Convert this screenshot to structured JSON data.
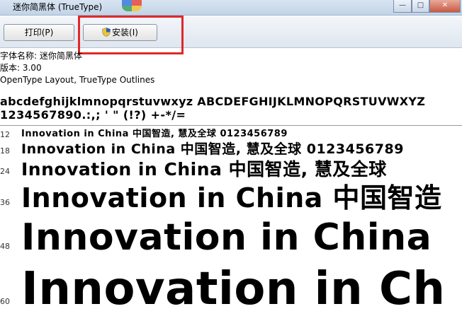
{
  "window": {
    "title": "迷你简黑体 (TrueType)",
    "controls": {
      "minimize": "—",
      "maximize": "□",
      "close": "✕"
    }
  },
  "toolbar": {
    "print_label": "打印(P)",
    "install_label": "安装(I)"
  },
  "info": {
    "font_name": "字体名称: 迷你简黑体",
    "version": "版本: 3.00",
    "outlines": "OpenType Layout, TrueType Outlines"
  },
  "glyphs": {
    "row1": "abcdefghijklmnopqrstuvwxyz ABCDEFGHIJKLMNOPQRSTUVWXYZ",
    "row2": "1234567890.:,; ' \" (!?) +-*/="
  },
  "samples": [
    {
      "size": "12",
      "text": "Innovation in China 中国智造, 慧及全球 0123456789"
    },
    {
      "size": "18",
      "text": "Innovation in China 中国智造, 慧及全球 0123456789"
    },
    {
      "size": "24",
      "text": "Innovation in China 中国智造, 慧及全球"
    },
    {
      "size": "36",
      "text": "Innovation in China 中国智造"
    },
    {
      "size": "48",
      "text": "Innovation in China"
    },
    {
      "size": "60",
      "text": "Innovation in Ch"
    }
  ],
  "colors": {
    "highlight": "#e0282a",
    "titlebar": "#c3d4e8"
  }
}
